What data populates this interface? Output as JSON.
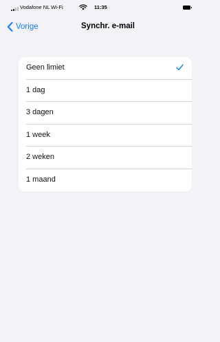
{
  "status_bar": {
    "carrier": "Vodafone NL Wi-Fi",
    "time": "11:35",
    "signal_bars_active": 2,
    "signal_bars_total": 4
  },
  "nav": {
    "back_label": "Vorige",
    "title": "Synchr. e-mail"
  },
  "options": [
    {
      "label": "Geen limiet",
      "selected": true
    },
    {
      "label": "1 dag",
      "selected": false
    },
    {
      "label": "3 dagen",
      "selected": false
    },
    {
      "label": "1 week",
      "selected": false
    },
    {
      "label": "2 weken",
      "selected": false
    },
    {
      "label": "1 maand",
      "selected": false
    }
  ],
  "colors": {
    "accent": "#147efb",
    "background": "#f2f2f7",
    "card": "#ffffff"
  },
  "icons": {
    "back": "chevron-left-icon",
    "selected": "checkmark-icon",
    "wifi": "wifi-icon",
    "battery": "battery-icon",
    "signal": "signal-strength-icon"
  }
}
